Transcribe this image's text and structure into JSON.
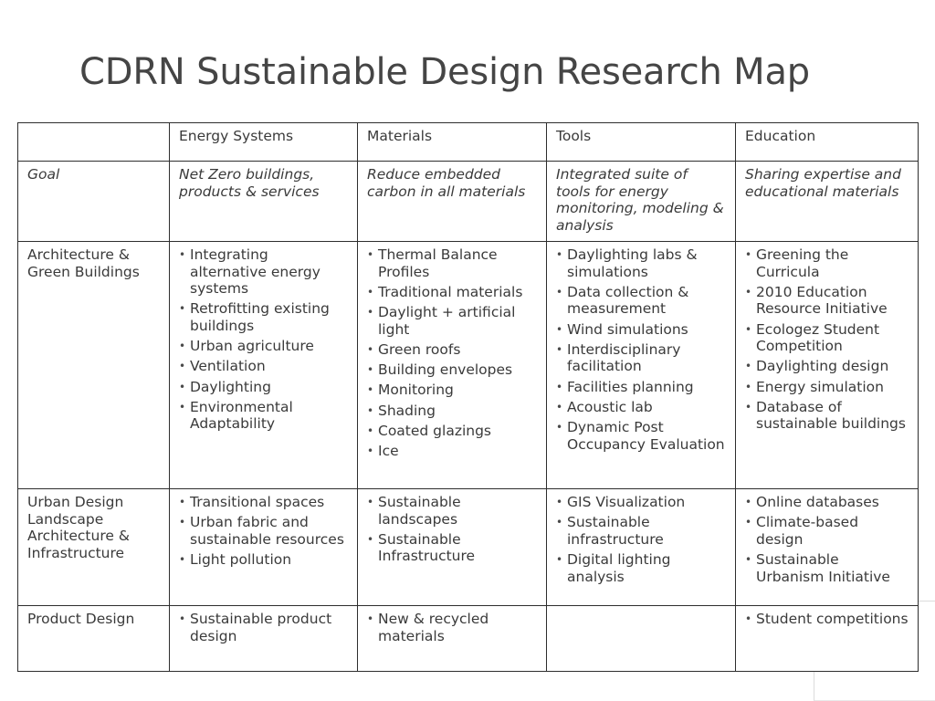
{
  "title": "CDRN Sustainable Design Research Map",
  "columns": [
    "",
    "Energy Systems",
    "Materials",
    "Tools",
    "Education"
  ],
  "goal_row": {
    "label": "Goal",
    "cells": [
      "Net Zero buildings, products & services",
      "Reduce embedded carbon in all materials",
      "Integrated suite of tools for energy monitoring, modeling & analysis",
      "Sharing expertise and educational materials"
    ]
  },
  "rows": [
    {
      "label": "Architecture & Green Buildings",
      "cells": [
        [
          "Integrating alternative energy systems",
          "Retrofitting existing buildings",
          "Urban agriculture",
          "Ventilation",
          "Daylighting",
          "Environmental Adaptability"
        ],
        [
          "Thermal Balance Profiles",
          "Traditional materials",
          "Daylight + artificial light",
          "Green roofs",
          "Building envelopes",
          "Monitoring",
          "Shading",
          "Coated glazings",
          "Ice"
        ],
        [
          "Daylighting labs & simulations",
          "Data collection & measurement",
          "Wind simulations",
          "Interdisciplinary facilitation",
          "Facilities planning",
          "Acoustic lab",
          "Dynamic Post Occupancy Evaluation"
        ],
        [
          "Greening the Curricula",
          "2010 Education Resource Initiative",
          "Ecologez Student Competition",
          "Daylighting design",
          "Energy simulation",
          "Database of sustainable buildings"
        ]
      ]
    },
    {
      "label": "Urban Design Landscape Architecture & Infrastructure",
      "cells": [
        [
          "Transitional spaces",
          "Urban fabric and sustainable resources",
          "Light pollution"
        ],
        [
          "Sustainable landscapes",
          "Sustainable Infrastructure"
        ],
        [
          "GIS Visualization",
          "Sustainable infrastructure",
          "Digital lighting analysis"
        ],
        [
          "Online databases",
          "Climate-based design",
          "Sustainable Urbanism Initiative"
        ]
      ]
    },
    {
      "label": "Product Design",
      "cells": [
        [
          "Sustainable product design"
        ],
        [
          "New & recycled materials"
        ],
        [],
        [
          "Student competitions"
        ]
      ]
    }
  ]
}
